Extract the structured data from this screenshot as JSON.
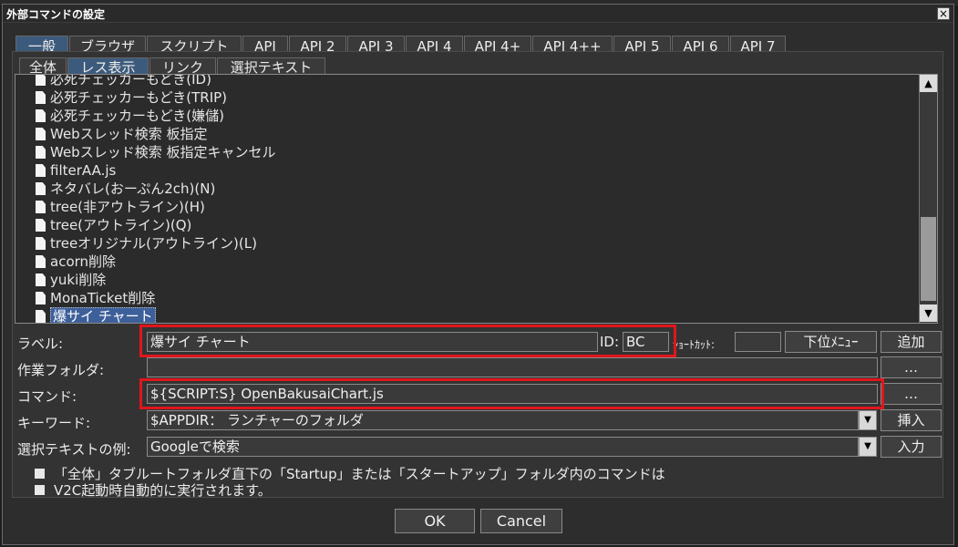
{
  "window": {
    "title": "外部コマンドの設定",
    "close": "×"
  },
  "tabs": [
    "一般",
    "ブラウザ",
    "スクリプト",
    "API",
    "API 2",
    "API 3",
    "API 4",
    "API 4+",
    "API 4++",
    "API 5",
    "API 6",
    "API 7"
  ],
  "subtabs": [
    "全体",
    "レス表示",
    "リンク",
    "選択テキスト"
  ],
  "list_items": [
    "必死チェッカーもどき(ID)",
    "必死チェッカーもどき(TRIP)",
    "必死チェッカーもどき(嫌儲)",
    "Webスレッド検索 板指定",
    "Webスレッド検索 板指定キャンセル",
    "filterAA.js",
    "ネタバレ(おーぷん2ch)(N)",
    "tree(非アウトライン)(H)",
    "tree(アウトライン)(Q)",
    "treeオリジナル(アウトライン)(L)",
    "acorn削除",
    "yuki削除",
    "MonaTicket削除",
    "爆サイ チャート"
  ],
  "selected_index": 13,
  "form": {
    "label_caption": "ラベル:",
    "label_value": "爆サイ チャート",
    "id_caption": "ID:",
    "id_value": "BC",
    "shortcut_caption": "ｼｮｰﾄｶｯﾄ:",
    "shortcut_value": "",
    "submenu_button": "下位ﾒﾆｭｰ",
    "add_button": "追加",
    "workdir_caption": "作業フォルダ:",
    "workdir_value": "",
    "browse_label": "…",
    "command_caption": "コマンド:",
    "command_value": "${SCRIPT:S} OpenBakusaiChart.js",
    "keyword_caption": "キーワード:",
    "keyword_value": "$APPDIR：  ランチャーのフォルダ",
    "insert_button": "挿入",
    "example_caption": "選択テキストの例:",
    "example_value": "Googleで検索",
    "input_button": "入力"
  },
  "notes": [
    "「全体」タブルートフォルダ直下の「Startup」または「スタートアップ」フォルダ内のコマンドは",
    "V2C起動時自動的に実行されます。"
  ],
  "footer": {
    "ok": "OK",
    "cancel": "Cancel"
  },
  "colors": {
    "highlight": "#e0161c",
    "selection": "#3d5f9a",
    "active_tab": "#3c5a7c"
  }
}
